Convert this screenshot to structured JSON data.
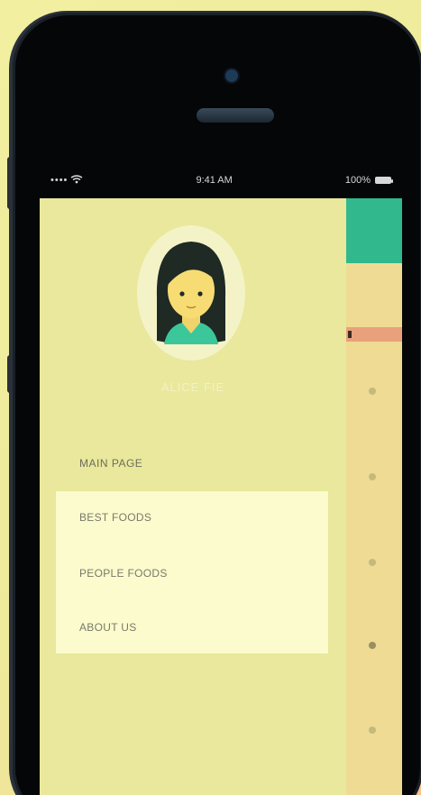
{
  "status_bar": {
    "carrier_signal": "••••",
    "wifi_icon": "wifi-icon",
    "time": "9:41 AM",
    "battery_percent": "100%",
    "battery_icon": "battery-icon"
  },
  "drawer": {
    "user_name": "ALICE FIE",
    "menu_main": "MAIN PAGE",
    "submenu": [
      {
        "label": "BEST FOODS"
      },
      {
        "label": "PEOPLE FOODS"
      },
      {
        "label": "ABOUT US"
      }
    ],
    "colors": {
      "drawer_bg": "#e9e89c",
      "submenu_bg": "#fbfbce",
      "accent_green": "#31b98d"
    }
  },
  "content": {
    "header_color": "#31b98d",
    "strip_color": "#e8a17b"
  }
}
